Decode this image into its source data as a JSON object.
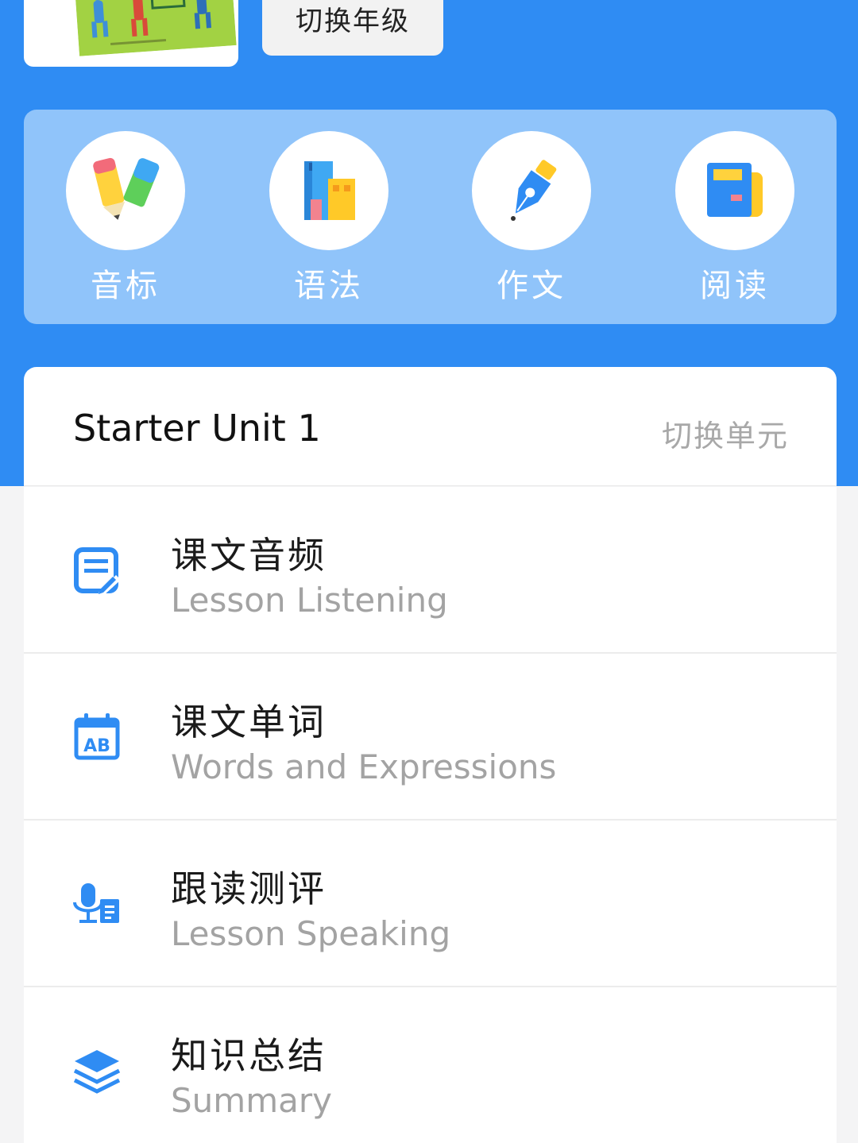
{
  "header": {
    "switch_grade_label": "切换年级"
  },
  "categories": [
    {
      "label": "音标",
      "icon": "pencils-icon"
    },
    {
      "label": "语法",
      "icon": "buildings-icon"
    },
    {
      "label": "作文",
      "icon": "pen-nib-icon"
    },
    {
      "label": "阅读",
      "icon": "book-icon"
    }
  ],
  "unit": {
    "title": "Starter Unit 1",
    "switch_label": "切换单元"
  },
  "lessons": [
    {
      "title": "课文音频",
      "subtitle": "Lesson Listening",
      "icon": "notes-edit-icon"
    },
    {
      "title": "课文单词",
      "subtitle": "Words and Expressions",
      "icon": "ab-calendar-icon"
    },
    {
      "title": "跟读测评",
      "subtitle": "Lesson Speaking",
      "icon": "microphone-icon"
    },
    {
      "title": "知识总结",
      "subtitle": "Summary",
      "icon": "layers-icon"
    }
  ],
  "colors": {
    "primary": "#2f8cf3",
    "panel": "#90c4fa",
    "icon_blue": "#2f8cf3",
    "muted_text": "#a3a3a3"
  }
}
